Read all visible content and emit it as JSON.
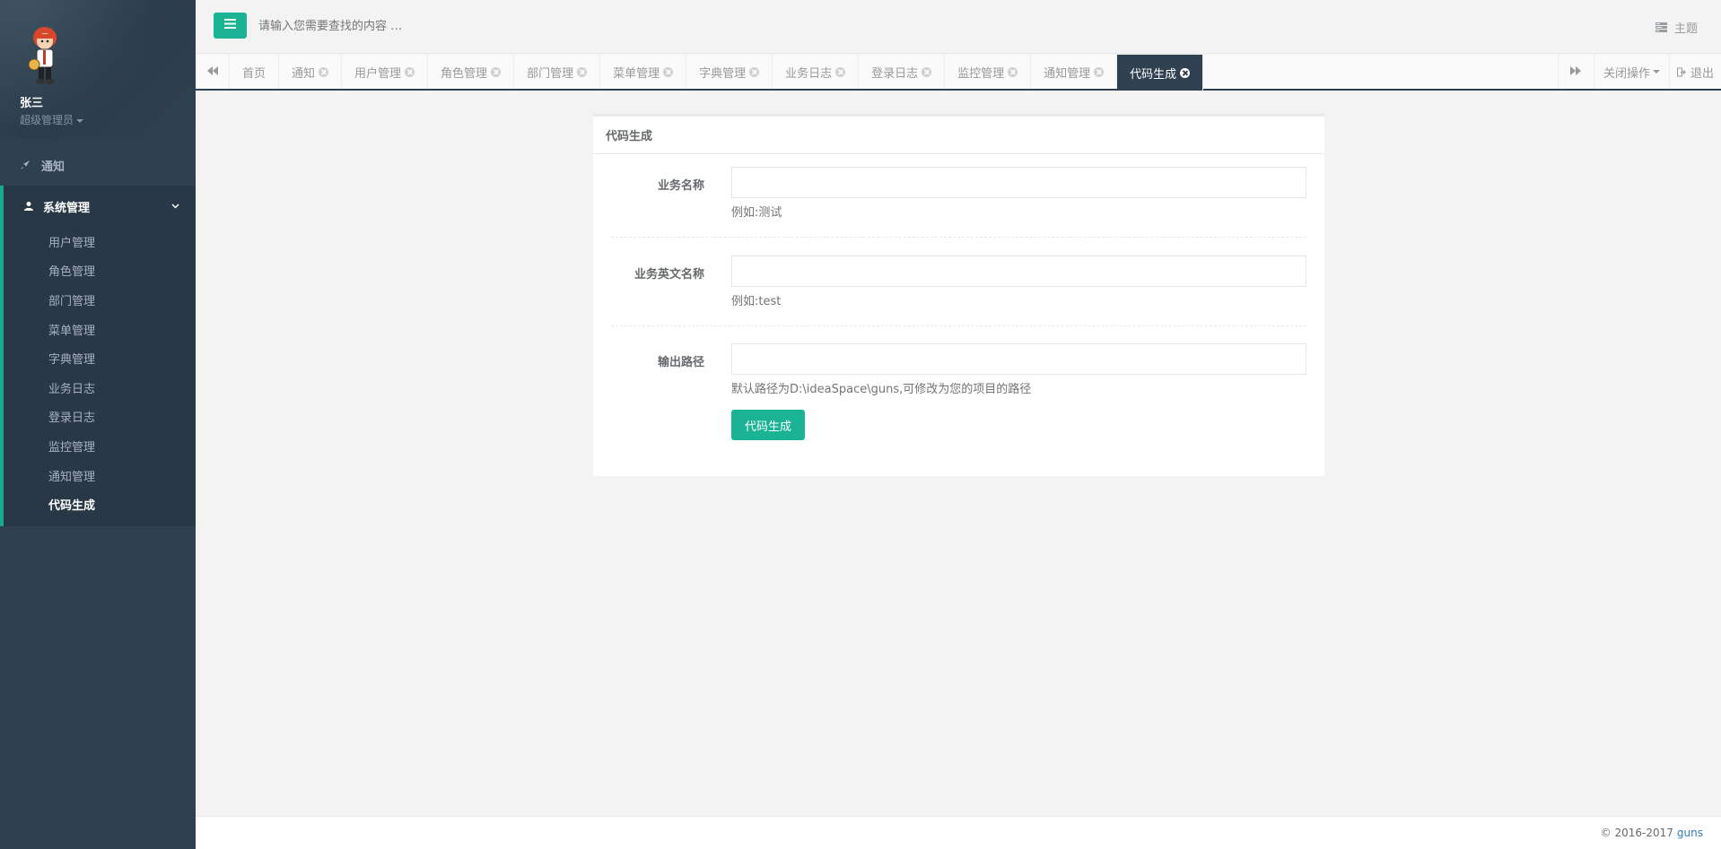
{
  "sidebar": {
    "user": {
      "name": "张三",
      "role": "超级管理员"
    },
    "top_item": {
      "label": "通知",
      "icon": "rocket-icon"
    },
    "group": {
      "label": "系统管理",
      "icon": "user-icon",
      "items": [
        {
          "label": "用户管理"
        },
        {
          "label": "角色管理"
        },
        {
          "label": "部门管理"
        },
        {
          "label": "菜单管理"
        },
        {
          "label": "字典管理"
        },
        {
          "label": "业务日志"
        },
        {
          "label": "登录日志"
        },
        {
          "label": "监控管理"
        },
        {
          "label": "通知管理"
        },
        {
          "label": "代码生成",
          "active": true
        }
      ]
    }
  },
  "topbar": {
    "search_placeholder": "请输入您需要查找的内容 …",
    "theme_label": "主题"
  },
  "tabs": {
    "items": [
      {
        "label": "首页",
        "closable": false
      },
      {
        "label": "通知",
        "closable": true
      },
      {
        "label": "用户管理",
        "closable": true
      },
      {
        "label": "角色管理",
        "closable": true
      },
      {
        "label": "部门管理",
        "closable": true
      },
      {
        "label": "菜单管理",
        "closable": true
      },
      {
        "label": "字典管理",
        "closable": true
      },
      {
        "label": "业务日志",
        "closable": true
      },
      {
        "label": "登录日志",
        "closable": true
      },
      {
        "label": "监控管理",
        "closable": true
      },
      {
        "label": "通知管理",
        "closable": true
      },
      {
        "label": "代码生成",
        "closable": true,
        "active": true
      }
    ],
    "close_ops_label": "关闭操作",
    "logout_label": "退出"
  },
  "panel": {
    "title": "代码生成",
    "fields": [
      {
        "label": "业务名称",
        "value": "",
        "help": "例如:测试"
      },
      {
        "label": "业务英文名称",
        "value": "",
        "help": "例如:test"
      },
      {
        "label": "输出路径",
        "value": "",
        "help": "默认路径为D:\\ideaSpace\\guns,可修改为您的项目的路径"
      }
    ],
    "submit_label": "代码生成"
  },
  "footer": {
    "copyright": "© 2016-2017",
    "link": "guns"
  },
  "colors": {
    "sidebar_bg": "#2f4050",
    "accent": "#1ab394",
    "page_bg": "#f3f3f4"
  }
}
